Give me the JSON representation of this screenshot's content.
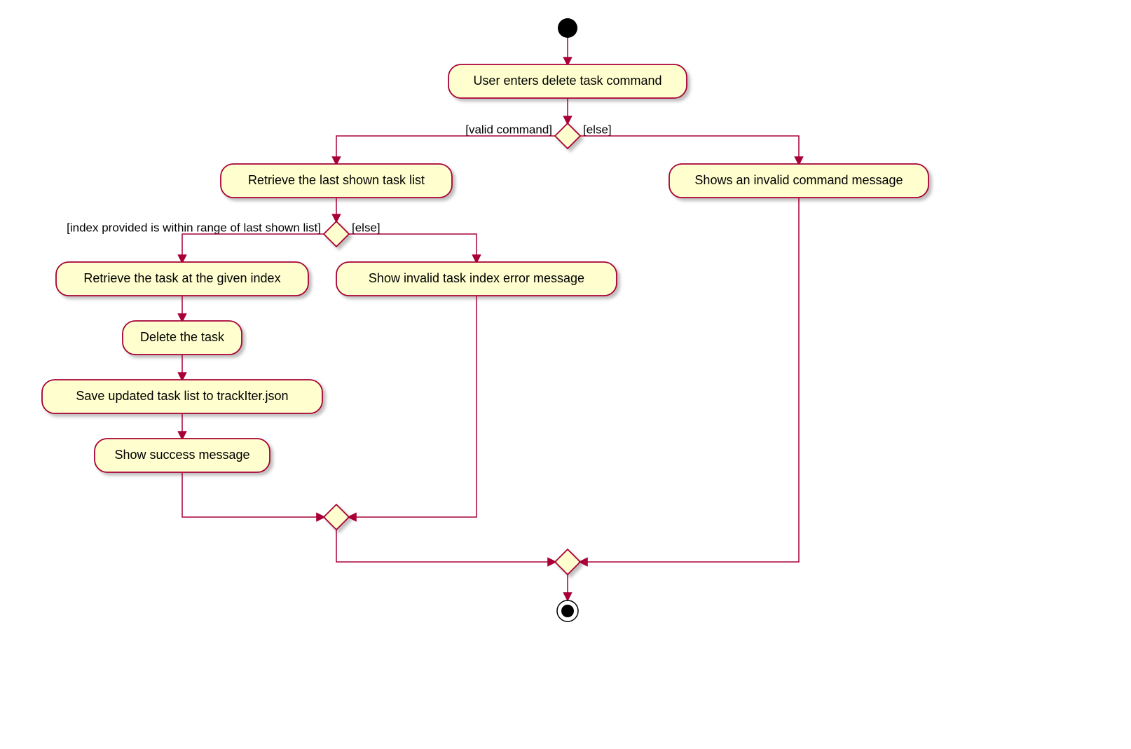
{
  "nodes": {
    "start": "",
    "enterCmd": "User enters delete task command",
    "retrieveList": "Retrieve the last shown task list",
    "invalidCmd": "Shows an invalid command message",
    "retrieveTask": "Retrieve the task at the given index",
    "invalidIndex": "Show invalid task index error message",
    "deleteTask": "Delete the task",
    "saveList": "Save updated task list to trackIter.json",
    "successMsg": "Show success message"
  },
  "guards": {
    "validCmd": "[valid command]",
    "else1": "[else]",
    "indexInRange": "[index provided is within range of last shown list]",
    "else2": "[else]"
  }
}
